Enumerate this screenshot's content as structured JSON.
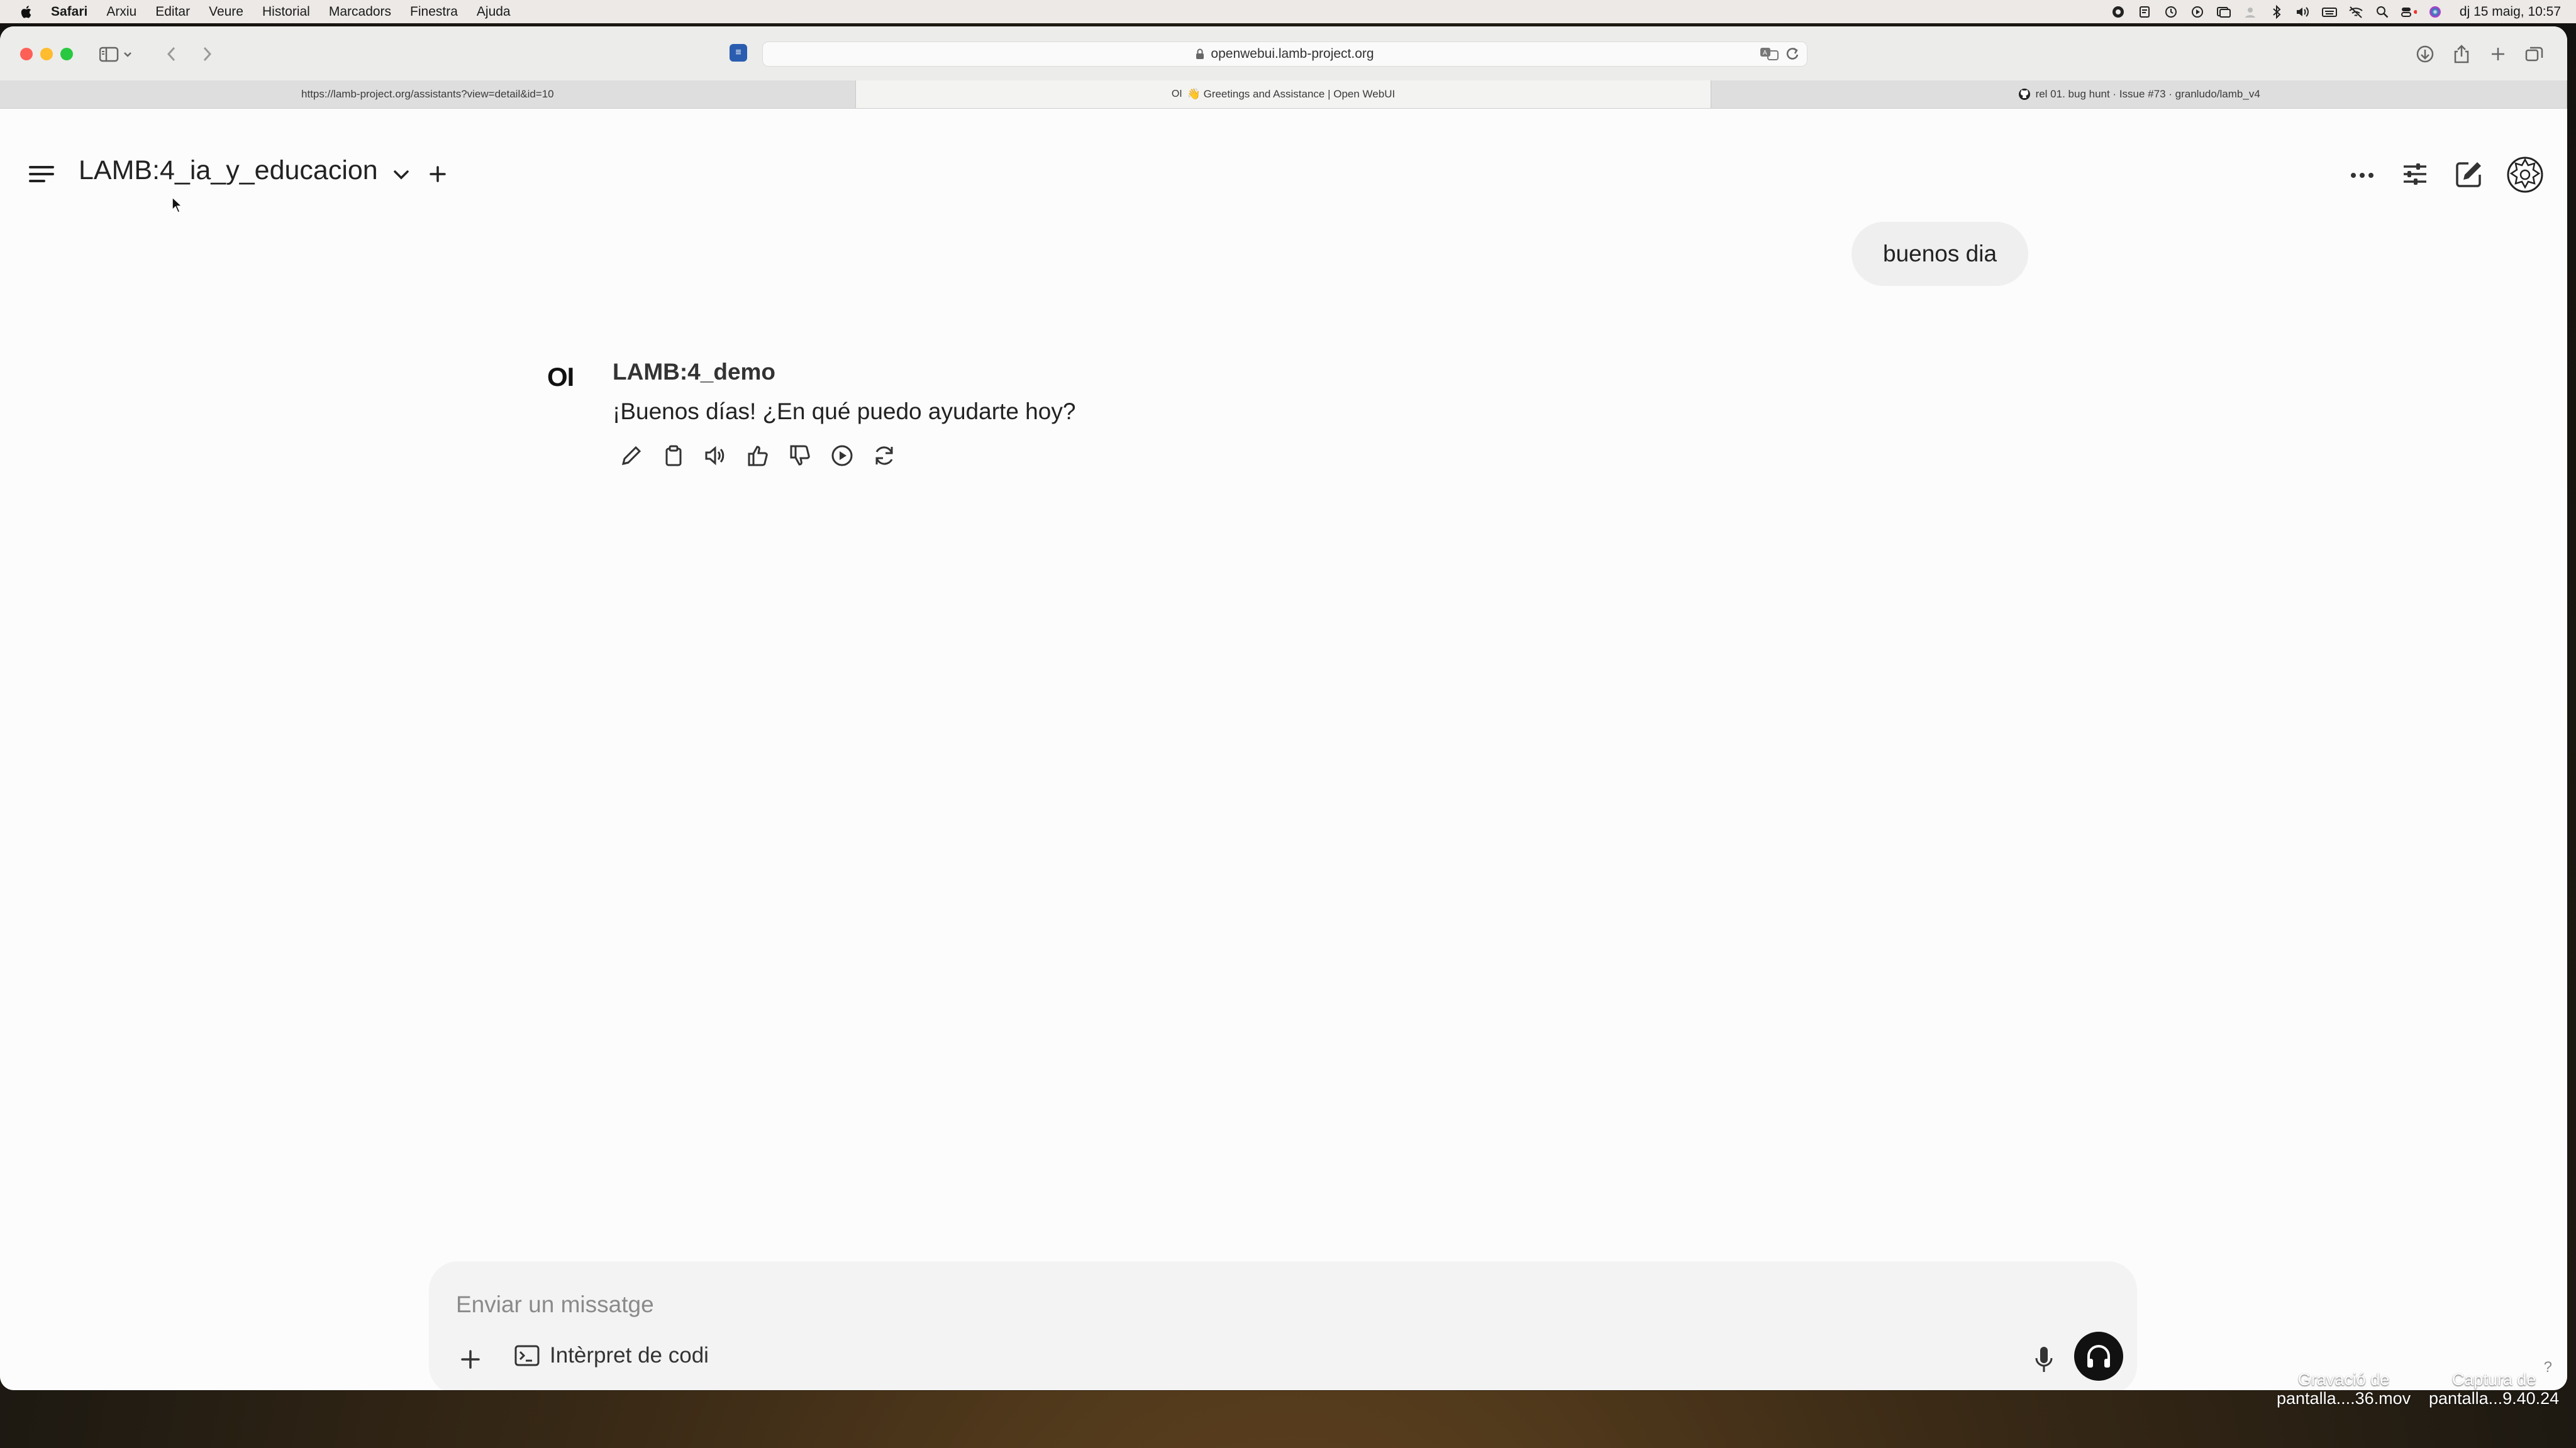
{
  "menubar": {
    "app_name": "Safari",
    "items": [
      "Arxiu",
      "Editar",
      "Veure",
      "Historial",
      "Marcadors",
      "Finestra",
      "Ajuda"
    ],
    "clock": "dj 15 maig, 10:57"
  },
  "browser": {
    "address": "openwebui.lamb-project.org",
    "extension_badge": "≡",
    "tabs": [
      {
        "title": "https://lamb-project.org/assistants?view=detail&id=10",
        "favicon": "",
        "active": false
      },
      {
        "title": "👋 Greetings and Assistance | Open WebUI",
        "favicon": "OI",
        "active": true
      },
      {
        "title": "rel 01. bug hunt · Issue #73 · granludo/lamb_v4",
        "favicon": "github-icon",
        "active": false
      }
    ]
  },
  "chat": {
    "model_selector": "LAMB:4_ia_y_educacion",
    "user_message": "buenos dia",
    "assistant": {
      "avatar_text": "OI",
      "name": "LAMB:4_demo",
      "message": "¡Buenos días! ¿En qué puedo ayudarte hoy?"
    }
  },
  "composer": {
    "placeholder": "Enviar un missatge",
    "tool_label": "Intèrpret de codi"
  },
  "help_label": "?",
  "desktop_files": [
    {
      "line1": "Gravació de",
      "line2": "pantalla....36.mov"
    },
    {
      "line1": "Captura de",
      "line2": "pantalla...9.40.24"
    }
  ]
}
